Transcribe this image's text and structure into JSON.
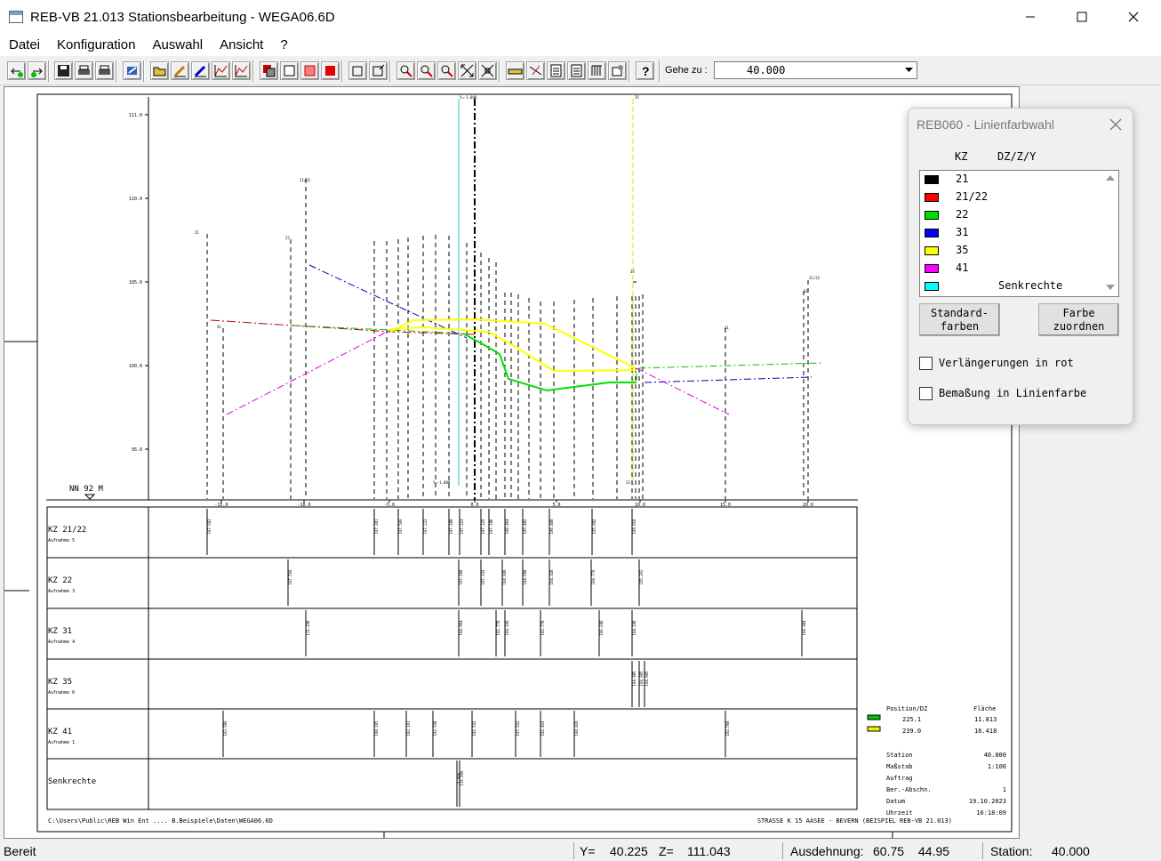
{
  "window": {
    "title": "REB-VB 21.013 Stationsbearbeitung - WEGA06.6D"
  },
  "menu": [
    "Datei",
    "Konfiguration",
    "Auswahl",
    "Ansicht",
    "?"
  ],
  "toolbar": {
    "goto_label": "Gehe zu :",
    "goto_value": "40.000"
  },
  "drawing": {
    "y_ticks": [
      "111.0",
      "110.0",
      "105.0",
      "100.0",
      "95.0"
    ],
    "nn_label": "NN  92 M",
    "x_ticks": [
      "-15.0",
      "-10.0",
      "-5.0",
      "0.0",
      "5.0",
      "10.0",
      "15.0",
      "20.0"
    ],
    "top_labels": [
      "Y=-1.000",
      "35"
    ],
    "point_labels": [
      "21",
      "21/22",
      "22",
      "35",
      "41",
      "41",
      "21/22",
      "31",
      "33",
      "Y=-1.000"
    ],
    "rows": [
      {
        "kz": "KZ 21/22",
        "sub": "Aufnahme 5",
        "vals": [
          "107.583",
          "107.281",
          "107.500",
          "107.223",
          "107.288",
          "107.223",
          "107.125",
          "107.186",
          "108.464",
          "105.482",
          "106.468",
          "105.992",
          "109.010"
        ]
      },
      {
        "kz": "KZ 22",
        "sub": "Aufnahme 3",
        "vals": [
          "107.530",
          "107.288",
          "107.133",
          "104.849",
          "104.098",
          "104.328",
          "104.770",
          "105.292"
        ]
      },
      {
        "kz": "KZ 31",
        "sub": "Aufnahme 4",
        "vals": [
          "111.108",
          "104.964",
          "102.778",
          "104.100",
          "102.778",
          "106.048",
          "104.108",
          "104.384"
        ]
      },
      {
        "kz": "KZ 35",
        "sub": "Aufnahme 6",
        "vals": [
          "104.985",
          "104.985",
          "104.985"
        ]
      },
      {
        "kz": "KZ 41",
        "sub": "Aufnahme 1",
        "vals": [
          "102.580",
          "108.105",
          "102.101",
          "102.538",
          "102.532",
          "107.522",
          "102.410",
          "104.420",
          "102.568"
        ]
      },
      {
        "kz": "Senkrechte",
        "sub": "",
        "vals": [
          "1.000",
          "111.000"
        ]
      }
    ],
    "footer_left": "C:\\Users\\Public\\REB Win Ent .... B.Beispiele\\Daten\\WEGA06.6D",
    "footer_right": "STRASSE K 15   AASEE - BEVERN (BEISPIEL REB-VB 21.013)",
    "legend": {
      "h1": "Position/DZ",
      "h2": "Fläche",
      "rows": [
        {
          "pos": "225.1",
          "area": "11.813",
          "color": "#00c000"
        },
        {
          "pos": "239.0",
          "area": "16.418",
          "color": "#f0f000"
        }
      ]
    },
    "info": [
      {
        "k": "Station",
        "v": "40.000"
      },
      {
        "k": "Maßstab",
        "v": "1:100"
      },
      {
        "k": "Auftrag",
        "v": ""
      },
      {
        "k": "Ber.-Abschn.",
        "v": "1"
      },
      {
        "k": "Datum",
        "v": "19.10.2023"
      },
      {
        "k": "Uhrzeit",
        "v": "16:18:09"
      }
    ]
  },
  "dialog": {
    "title": "REB060 - Linienfarbwahl",
    "col_kz": "KZ",
    "col_dz": "DZ/Z/Y",
    "items": [
      {
        "label": "21",
        "color": "#000000"
      },
      {
        "label": "21/22",
        "color": "#ff0000"
      },
      {
        "label": "22",
        "color": "#00e000"
      },
      {
        "label": "31",
        "color": "#0000ff"
      },
      {
        "label": "35",
        "color": "#ffff00"
      },
      {
        "label": "41",
        "color": "#ff00ff"
      },
      {
        "label": "Senkrechte",
        "color": "#00ffff"
      }
    ],
    "btn_std": [
      "Standard-",
      "farben"
    ],
    "btn_assign": [
      "Farbe",
      "zuordnen"
    ],
    "cb1": "Verlängerungen in rot",
    "cb2": "Bemaßung in Linienfarbe"
  },
  "status": {
    "ready": "Bereit",
    "y_label": "Y=",
    "y_val": "40.225",
    "z_label": "Z=",
    "z_val": "111.043",
    "ext_label": "Ausdehnung:",
    "ext_a": "60.75",
    "ext_b": "44.95",
    "st_label": "Station:",
    "st_val": "40.000"
  }
}
